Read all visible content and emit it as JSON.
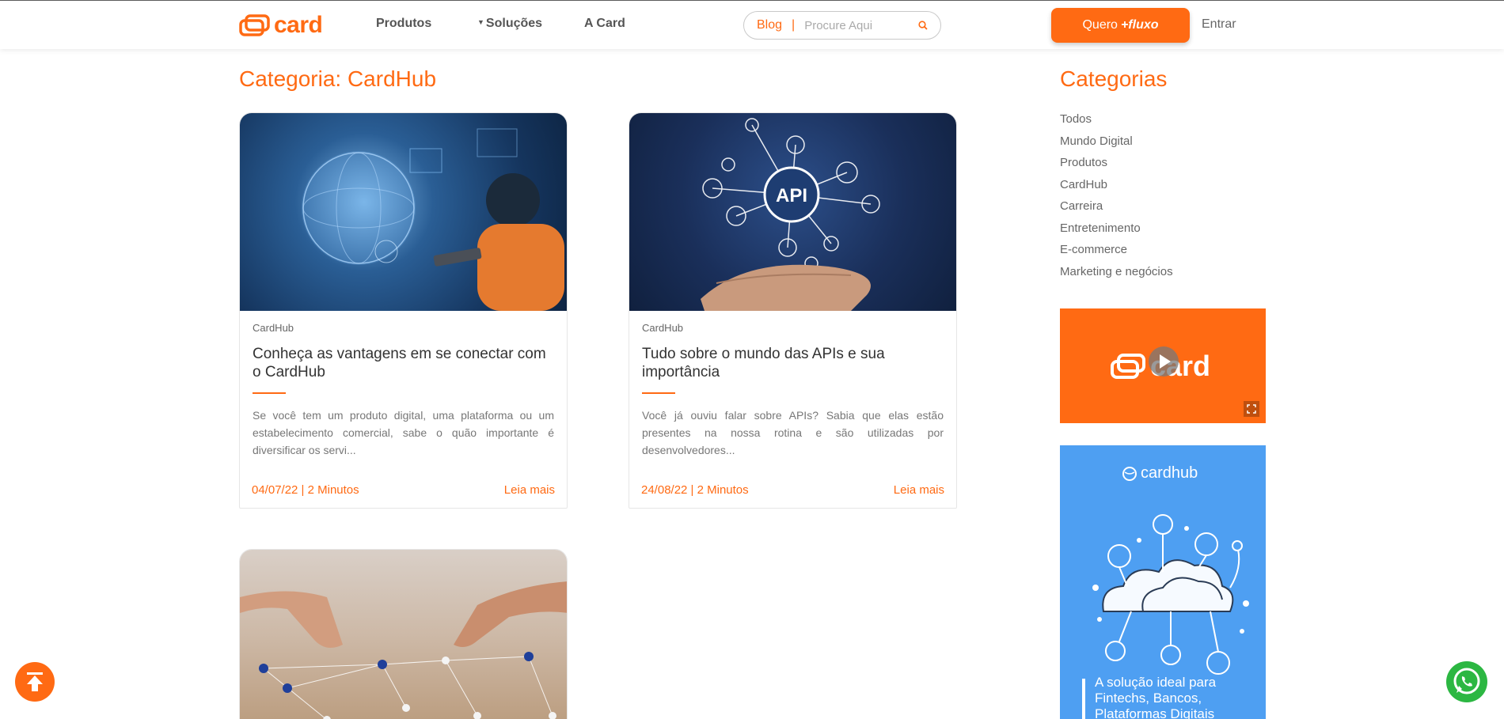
{
  "header": {
    "logo_text": "card",
    "nav": [
      "Produtos",
      "Soluções",
      "A Card"
    ],
    "search": {
      "label": "Blog",
      "placeholder": "Procure Aqui"
    },
    "cta_prefix": "Quero",
    "cta_emph": "+fluxo",
    "login": "Entrar"
  },
  "page_title": "Categoria: CardHub",
  "posts": [
    {
      "category": "CardHub",
      "title": "Conheça as vantagens em se conectar com o CardHub",
      "excerpt": "Se você tem um produto digital, uma plataforma ou um estabelecimento comercial, sabe o quão importante é diversificar os servi...",
      "meta": "04/07/22 | 2 Minutos",
      "more": "Leia mais"
    },
    {
      "category": "CardHub",
      "title": "Tudo sobre o mundo das APIs e sua importância",
      "excerpt": "Você já ouviu falar sobre APIs? Sabia que elas estão presentes na nossa rotina e são utilizadas por desenvolvedores...",
      "meta": "24/08/22 | 2 Minutos",
      "more": "Leia mais",
      "image_text": "API"
    }
  ],
  "sidebar": {
    "title": "Categorias",
    "categories": [
      "Todos",
      "Mundo Digital",
      "Produtos",
      "CardHub",
      "Carreira",
      "Entretenimento",
      "E-commerce",
      "Marketing e negócios"
    ],
    "video_logo_text": "card",
    "ad": {
      "logo_text": "cardhub",
      "text": "A solução ideal para Fintechs, Bancos, Plataformas Digitais"
    }
  },
  "colors": {
    "brand": "#ff6a13",
    "ad_blue": "#4e9ff2",
    "whatsapp": "#2cb742"
  }
}
